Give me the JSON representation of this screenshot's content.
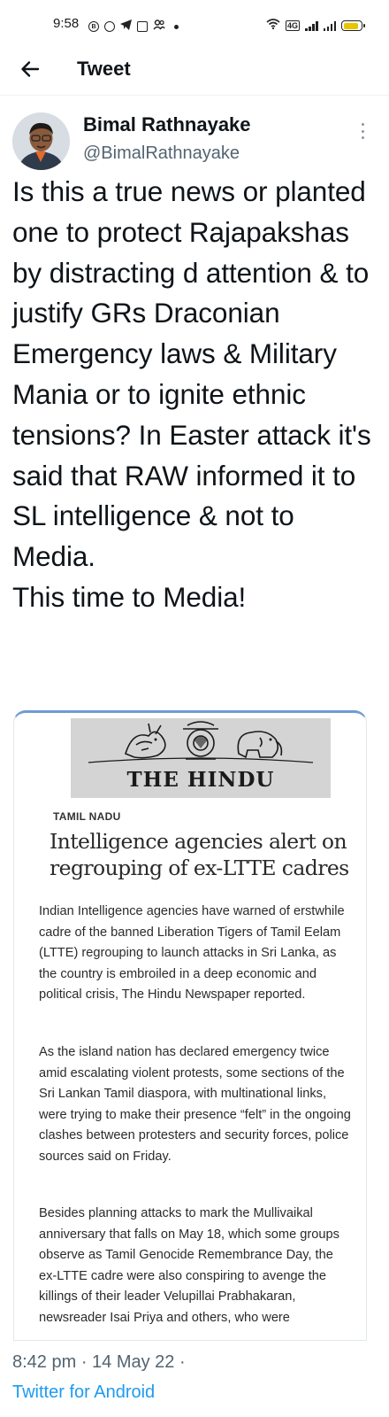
{
  "status_bar": {
    "time": "9:58",
    "app_icons": [
      "B",
      "whatsapp-icon",
      "telegram-icon",
      "news-icon",
      "group-icon"
    ],
    "battery_color": "#e9c400"
  },
  "header": {
    "title": "Tweet"
  },
  "tweet": {
    "author_name": "Bimal Rathnayake",
    "author_handle": "@BimalRathnayake",
    "text": "Is this a true news or planted one to protect Rajapakshas by distracting d attention & to justify GRs Draconian Emergency laws & Military Mania or to ignite ethnic tensions? In Easter attack it's said that RAW informed it to SL intelligence & not to Media.\nThis time to Media!",
    "timestamp": "8:42 pm · 14 May 22 ·",
    "source": "Twitter for Android"
  },
  "media": {
    "masthead": "THE HINDU",
    "section": "TAMIL NADU",
    "headline": "Intelligence agencies alert on regrouping of ex-LTTE cadres",
    "paragraphs": [
      "Indian Intelligence agencies have warned of erstwhile cadre of the banned Liberation Tigers of Tamil Eelam (LTTE) regrouping to launch attacks in Sri Lanka, as the country is embroiled in a deep economic and political crisis, The Hindu Newspaper reported.",
      "As the island nation has declared emergency twice amid escalating violent protests, some sections of the Sri Lankan Tamil diaspora, with multinational links, were trying to make their presence “felt” in the ongoing clashes between protesters and security forces, police sources said on Friday.",
      "Besides planning attacks to mark the Mullivaikal anniversary that falls on May 18, which some groups observe as Tamil Genocide Remembrance Day, the ex-LTTE cadre were also conspiring to avenge the killings of their leader Velupillai Prabhakaran, newsreader Isai Priya and others, who were"
    ]
  },
  "colors": {
    "text_primary": "#0f1419",
    "text_secondary": "#536471",
    "link": "#1d9bf0",
    "card_top_border": "#6f9cd3"
  }
}
